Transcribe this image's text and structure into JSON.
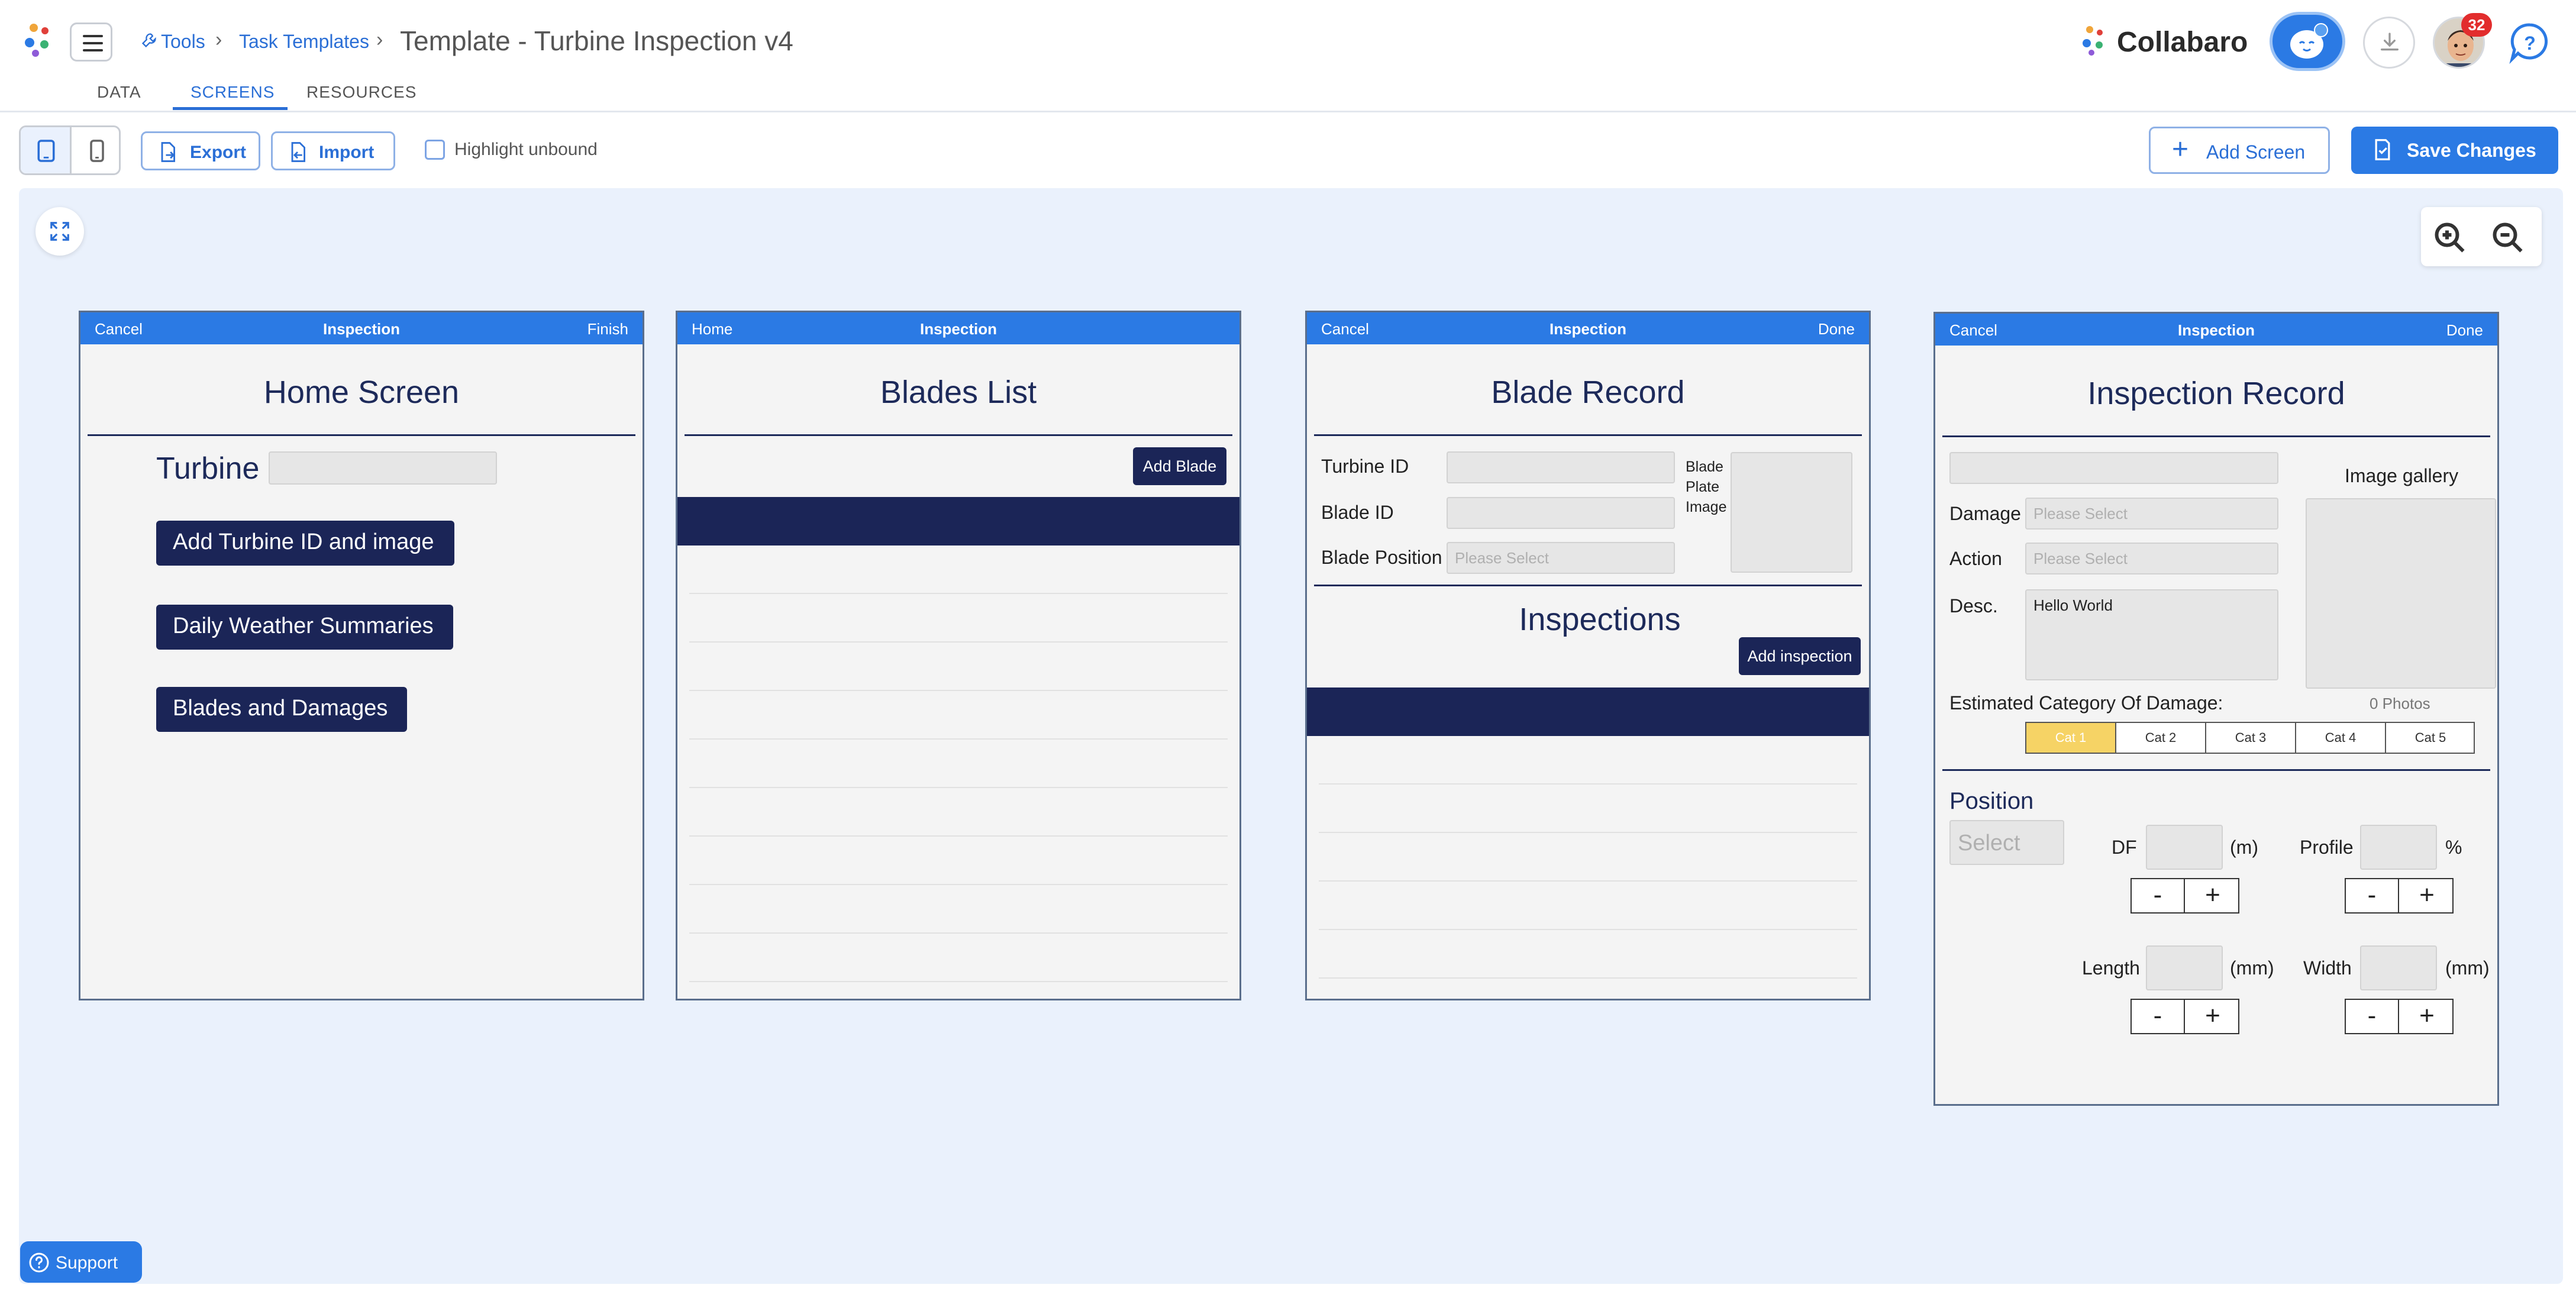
{
  "header": {
    "breadcrumb": [
      "Tools",
      "Task Templates"
    ],
    "separator": "›",
    "title": "Template - Turbine Inspection v4",
    "brand": "Collabaro",
    "notification_count": "32",
    "help_glyph": "?"
  },
  "tabs": [
    "DATA",
    "SCREENS",
    "RESOURCES"
  ],
  "toolbar": {
    "export_label": "Export",
    "import_label": "Import",
    "highlight_label": "Highlight unbound",
    "add_screen_label": "Add Screen",
    "save_label": "Save Changes",
    "add_glyph": "+"
  },
  "support_label": "Support",
  "screens": {
    "home": {
      "header": {
        "left": "Cancel",
        "center": "Inspection",
        "right": "Finish"
      },
      "title": "Home Screen",
      "turbine_label": "Turbine",
      "buttons": [
        "Add Turbine ID and image",
        "Daily Weather Summaries",
        "Blades and Damages"
      ]
    },
    "blades": {
      "header": {
        "left": "Home",
        "center": "Inspection",
        "right": ""
      },
      "title": "Blades List",
      "add_label": "Add Blade"
    },
    "blade_record": {
      "header": {
        "left": "Cancel",
        "center": "Inspection",
        "right": "Done"
      },
      "title": "Blade Record",
      "turbine_id_label": "Turbine ID",
      "blade_id_label": "Blade ID",
      "blade_position_label": "Blade Position",
      "blade_position_placeholder": "Please Select",
      "plate_label": "Blade Plate Image",
      "inspections_title": "Inspections",
      "add_inspection_label": "Add inspection"
    },
    "inspection_record": {
      "header": {
        "left": "Cancel",
        "center": "Inspection",
        "right": "Done"
      },
      "title": "Inspection Record",
      "damage_label": "Damage",
      "damage_placeholder": "Please Select",
      "action_label": "Action",
      "action_placeholder": "Please Select",
      "desc_label": "Desc.",
      "desc_value": "Hello World",
      "gallery_label": "Image gallery",
      "photos_count": "0 Photos",
      "category_label": "Estimated Category Of Damage:",
      "categories": [
        "Cat 1",
        "Cat 2",
        "Cat 3",
        "Cat 4",
        "Cat 5"
      ],
      "selected_category": "Cat 1",
      "position_label": "Position",
      "select_placeholder": "Select",
      "df_label": "DF",
      "df_unit": "(m)",
      "profile_label": "Profile",
      "profile_unit": "%",
      "length_label": "Length",
      "length_unit": "(mm)",
      "width_label": "Width",
      "width_unit": "(mm)",
      "minus": "-",
      "plus": "+"
    }
  },
  "colors": {
    "accent": "#2b7ae4",
    "navy": "#1b2557",
    "canvas": "#eaf1fc",
    "selected_category": "#f6d365",
    "badge": "#e22d2d"
  }
}
